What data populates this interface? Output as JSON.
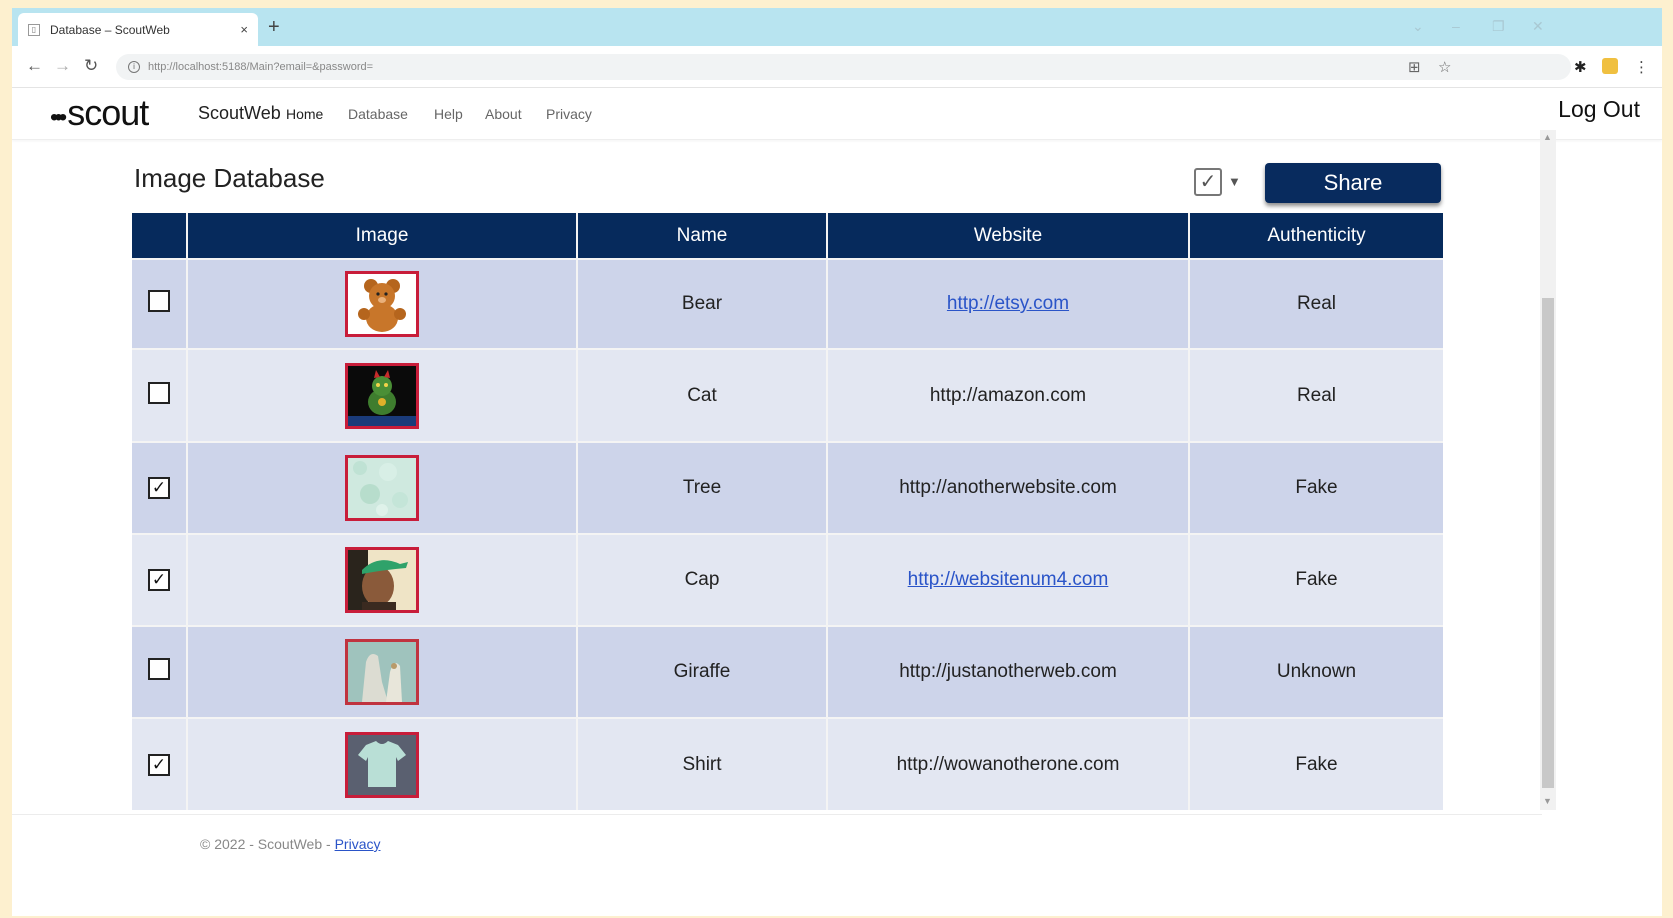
{
  "browser": {
    "tab_title": "Database – ScoutWeb",
    "url": "http://localhost:5188/Main?email=&password=",
    "new_tab": "+",
    "close_tab": "×"
  },
  "site": {
    "logo_mark": "•••",
    "logo_text": "scout",
    "brand": "ScoutWeb",
    "nav": {
      "home": "Home",
      "database": "Database",
      "help": "Help",
      "about": "About",
      "privacy": "Privacy"
    },
    "logout": "Log Out"
  },
  "page": {
    "title": "Image Database",
    "share_label": "Share",
    "bulk_select_checked": true
  },
  "table": {
    "headers": {
      "image": "Image",
      "name": "Name",
      "website": "Website",
      "authenticity": "Authenticity"
    },
    "rows": [
      {
        "checked": false,
        "image_icon": "teddy-bear-thumbnail",
        "name": "Bear",
        "website": "http://etsy.com",
        "website_linked": true,
        "authenticity": "Real"
      },
      {
        "checked": false,
        "image_icon": "lucky-cat-thumbnail",
        "name": "Cat",
        "website": "http://amazon.com",
        "website_linked": false,
        "authenticity": "Real"
      },
      {
        "checked": true,
        "image_icon": "tree-texture-thumbnail",
        "name": "Tree",
        "website": "http://anotherwebsite.com",
        "website_linked": false,
        "authenticity": "Fake"
      },
      {
        "checked": true,
        "image_icon": "man-in-cap-thumbnail",
        "name": "Cap",
        "website": "http://websitenum4.com",
        "website_linked": true,
        "authenticity": "Fake"
      },
      {
        "checked": false,
        "image_icon": "giraffe-thumbnail",
        "name": "Giraffe",
        "website": "http://justanotherweb.com",
        "website_linked": false,
        "authenticity": "Unknown"
      },
      {
        "checked": true,
        "image_icon": "shirt-thumbnail",
        "name": "Shirt",
        "website": "http://wowanotherone.com",
        "website_linked": false,
        "authenticity": "Fake"
      }
    ]
  },
  "footer": {
    "copyright": "© 2022 - ScoutWeb - ",
    "privacy": "Privacy"
  },
  "colors": {
    "header_navy": "#062a5c",
    "share_navy": "#082b5e",
    "row_odd": "#cdd4ea",
    "row_even": "#e3e7f2",
    "thumb_border": "#c81d3a",
    "link_blue": "#2a54c8"
  }
}
